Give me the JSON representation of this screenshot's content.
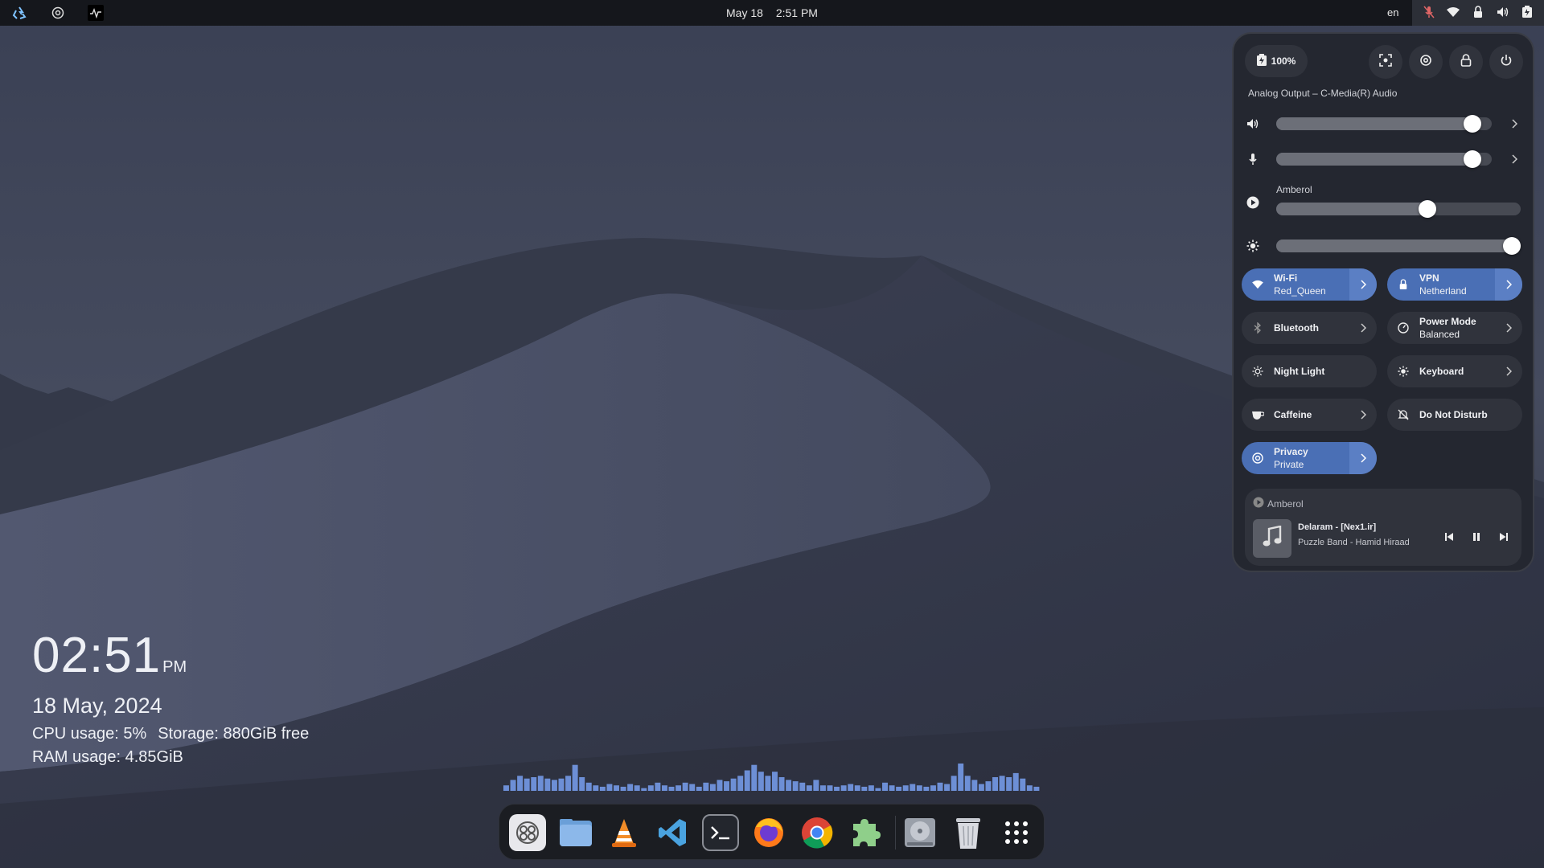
{
  "topbar": {
    "left_icons": [
      "recycle-logo-icon",
      "disc-icon",
      "activity-monitor-icon"
    ],
    "date": "May 18",
    "time": "2:51 PM",
    "language": "en",
    "status_icons": [
      "mic-muted-icon",
      "wifi-icon",
      "vpn-icon",
      "volume-icon",
      "battery-icon"
    ]
  },
  "desktop_widget": {
    "time": "02:51",
    "ampm": "PM",
    "date": "18 May, 2024",
    "cpu": "CPU usage: 5%",
    "storage": "Storage: 880GiB free",
    "ram": "RAM usage: 4.85GiB"
  },
  "visualizer": {
    "levels": [
      0.2,
      0.4,
      0.55,
      0.45,
      0.5,
      0.55,
      0.45,
      0.4,
      0.45,
      0.55,
      0.95,
      0.5,
      0.3,
      0.2,
      0.15,
      0.25,
      0.2,
      0.15,
      0.25,
      0.2,
      0.1,
      0.2,
      0.3,
      0.2,
      0.15,
      0.2,
      0.3,
      0.25,
      0.15,
      0.3,
      0.25,
      0.4,
      0.35,
      0.45,
      0.55,
      0.75,
      0.95,
      0.7,
      0.55,
      0.7,
      0.5,
      0.4,
      0.35,
      0.3,
      0.2,
      0.4,
      0.2,
      0.2,
      0.15,
      0.2,
      0.25,
      0.2,
      0.15,
      0.2,
      0.1,
      0.3,
      0.2,
      0.15,
      0.2,
      0.25,
      0.2,
      0.15,
      0.2,
      0.3,
      0.25,
      0.55,
      1.0,
      0.55,
      0.4,
      0.25,
      0.35,
      0.5,
      0.55,
      0.5,
      0.65,
      0.45,
      0.2,
      0.15
    ]
  },
  "dock": {
    "apps": [
      {
        "name": "system-app-icon"
      },
      {
        "name": "files-icon"
      },
      {
        "name": "vlc-icon"
      },
      {
        "name": "vscode-icon"
      },
      {
        "name": "terminal-icon"
      },
      {
        "name": "firefox-icon"
      },
      {
        "name": "chrome-icon"
      },
      {
        "name": "extensions-icon"
      },
      {
        "name": "disk-icon"
      },
      {
        "name": "trash-icon"
      },
      {
        "name": "app-grid-icon"
      }
    ]
  },
  "quick_settings": {
    "battery_label": "100%",
    "output_device": "Analog Output – C-Media(R) Audio",
    "volume_level": 0.91,
    "mic_level": 0.91,
    "app_stream_label": "Amberol",
    "app_stream_level": 0.62,
    "brightness_level": 1.0,
    "tiles": {
      "wifi": {
        "title": "Wi-Fi",
        "subtitle": "Red_Queen"
      },
      "vpn": {
        "title": "VPN",
        "subtitle": "Netherland"
      },
      "bluetooth": {
        "title": "Bluetooth"
      },
      "power_mode": {
        "title": "Power Mode",
        "subtitle": "Balanced"
      },
      "night_light": {
        "title": "Night Light"
      },
      "keyboard": {
        "title": "Keyboard"
      },
      "caffeine": {
        "title": "Caffeine"
      },
      "dnd": {
        "title": "Do Not Disturb"
      },
      "privacy": {
        "title": "Privacy",
        "subtitle": "Private"
      }
    },
    "media": {
      "app": "Amberol",
      "title": "Delaram - [Nex1.ir]",
      "artist": "Puzzle Band - Hamid Hiraad"
    }
  },
  "colors": {
    "accent": "#4a6fb5",
    "panel_bg": "#242730",
    "tile_bg": "#30333c",
    "visualizer": "#6d8fd6"
  }
}
